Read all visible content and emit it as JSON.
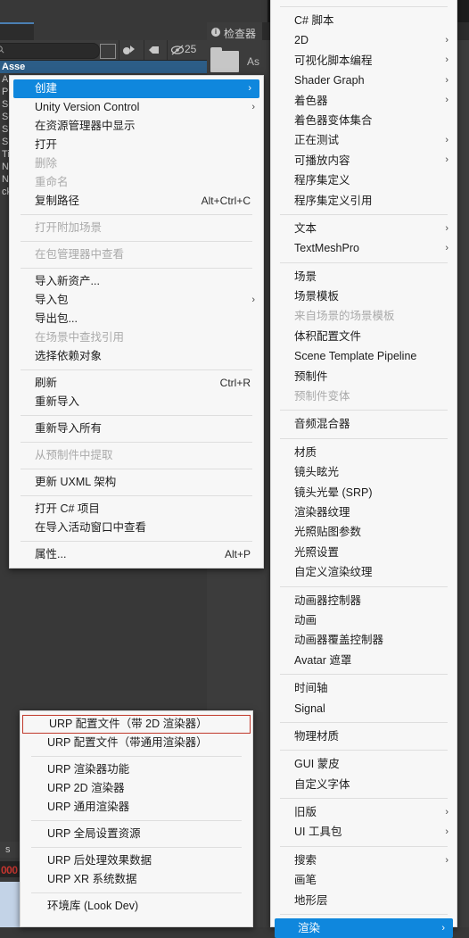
{
  "editor": {
    "project_panel": {
      "tab_title": "",
      "search_placeholder": "",
      "search_value": "",
      "visible_count": "25",
      "tree_items": [
        "Asse",
        "An",
        "Pr",
        "Sc",
        "Sc",
        "Sh",
        "Sp",
        "Tile",
        "Ne",
        "Ne",
        "ck"
      ]
    },
    "inspector_panel": {
      "tab_label": "检查器",
      "info_glyph": "i",
      "asset_label": "As"
    },
    "console": {
      "tab_label": "s",
      "error_text": "000"
    }
  },
  "menus": {
    "main": {
      "name": "资源上下文菜单",
      "items": [
        {
          "label": "创建",
          "arrow": true,
          "highlight": true
        },
        {
          "label": "Unity Version Control",
          "arrow": true
        },
        {
          "label": "在资源管理器中显示"
        },
        {
          "label": "打开"
        },
        {
          "label": "删除",
          "disabled": true
        },
        {
          "label": "重命名",
          "disabled": true
        },
        {
          "label": "复制路径",
          "shortcut": "Alt+Ctrl+C"
        },
        {
          "separator": true
        },
        {
          "label": "打开附加场景",
          "disabled": true
        },
        {
          "separator": true
        },
        {
          "label": "在包管理器中查看",
          "disabled": true
        },
        {
          "separator": true
        },
        {
          "label": "导入新资产..."
        },
        {
          "label": "导入包",
          "arrow": true
        },
        {
          "label": "导出包..."
        },
        {
          "label": "在场景中查找引用",
          "disabled": true
        },
        {
          "label": "选择依赖对象"
        },
        {
          "separator": true
        },
        {
          "label": "刷新",
          "shortcut": "Ctrl+R"
        },
        {
          "label": "重新导入"
        },
        {
          "separator": true
        },
        {
          "label": "重新导入所有"
        },
        {
          "separator": true
        },
        {
          "label": "从预制件中提取",
          "disabled": true
        },
        {
          "separator": true
        },
        {
          "label": "更新 UXML 架构"
        },
        {
          "separator": true
        },
        {
          "label": "打开 C# 项目"
        },
        {
          "label": "在导入活动窗口中查看"
        },
        {
          "separator": true
        },
        {
          "label": "属性...",
          "shortcut": "Alt+P"
        }
      ]
    },
    "create": {
      "name": "创建子菜单",
      "items": [
        {
          "separator": true
        },
        {
          "label": "C# 脚本"
        },
        {
          "label": "2D",
          "arrow": true
        },
        {
          "label": "可视化脚本编程",
          "arrow": true
        },
        {
          "label": "Shader Graph",
          "arrow": true
        },
        {
          "label": "着色器",
          "arrow": true
        },
        {
          "label": "着色器变体集合"
        },
        {
          "label": "正在测试",
          "arrow": true
        },
        {
          "label": "可播放内容",
          "arrow": true
        },
        {
          "label": "程序集定义"
        },
        {
          "label": "程序集定义引用"
        },
        {
          "separator": true
        },
        {
          "label": "文本",
          "arrow": true
        },
        {
          "label": "TextMeshPro",
          "arrow": true
        },
        {
          "separator": true
        },
        {
          "label": "场景"
        },
        {
          "label": "场景模板"
        },
        {
          "label": "来自场景的场景模板",
          "disabled": true
        },
        {
          "label": "体积配置文件"
        },
        {
          "label": "Scene Template Pipeline"
        },
        {
          "label": "预制件"
        },
        {
          "label": "预制件变体",
          "disabled": true
        },
        {
          "separator": true
        },
        {
          "label": "音频混合器"
        },
        {
          "separator": true
        },
        {
          "label": "材质"
        },
        {
          "label": "镜头眩光"
        },
        {
          "label": "镜头光晕 (SRP)"
        },
        {
          "label": "渲染器纹理"
        },
        {
          "label": "光照贴图参数"
        },
        {
          "label": "光照设置"
        },
        {
          "label": "自定义渲染纹理"
        },
        {
          "separator": true
        },
        {
          "label": "动画器控制器"
        },
        {
          "label": "动画"
        },
        {
          "label": "动画器覆盖控制器"
        },
        {
          "label": "Avatar 遮罩"
        },
        {
          "separator": true
        },
        {
          "label": "时间轴"
        },
        {
          "label": "Signal"
        },
        {
          "separator": true
        },
        {
          "label": "物理材质"
        },
        {
          "separator": true
        },
        {
          "label": "GUI 蒙皮"
        },
        {
          "label": "自定义字体"
        },
        {
          "separator": true
        },
        {
          "label": "旧版",
          "arrow": true
        },
        {
          "label": "UI 工具包",
          "arrow": true
        },
        {
          "separator": true
        },
        {
          "label": "搜索",
          "arrow": true
        },
        {
          "label": "画笔"
        },
        {
          "label": "地形层"
        },
        {
          "separator": true
        },
        {
          "label": "渲染",
          "arrow": true,
          "highlight": true
        }
      ]
    },
    "urp": {
      "name": "渲染 URP 子菜单",
      "items": [
        {
          "label": "URP 配置文件（带 2D 渲染器）",
          "boxed": true
        },
        {
          "label": "URP 配置文件（带通用渲染器）"
        },
        {
          "separator": true
        },
        {
          "label": "URP 渲染器功能"
        },
        {
          "label": "URP 2D 渲染器"
        },
        {
          "label": "URP 通用渲染器"
        },
        {
          "separator": true
        },
        {
          "label": "URP 全局设置资源"
        },
        {
          "separator": true
        },
        {
          "label": "URP 后处理效果数据"
        },
        {
          "label": "URP XR 系统数据"
        },
        {
          "separator": true
        },
        {
          "label": "环境库 (Look Dev)"
        }
      ]
    }
  },
  "colors": {
    "accent": "#0f87dd",
    "menu_bg": "#f7f7f7",
    "editor_bg": "#383838",
    "highlight_box": "#c0392b",
    "error_text": "#c3352f"
  }
}
